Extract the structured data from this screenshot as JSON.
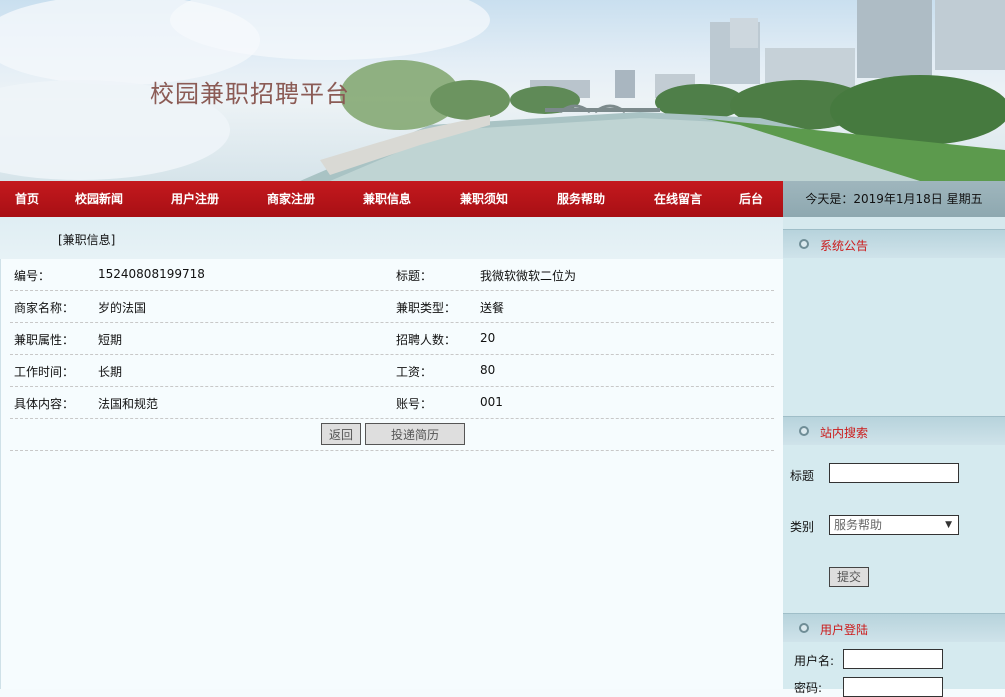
{
  "header": {
    "site_title": "校园兼职招聘平台"
  },
  "nav": {
    "items": [
      "首页",
      "校园新闻",
      "用户注册",
      "商家注册",
      "兼职信息",
      "兼职须知",
      "服务帮助",
      "在线留言",
      "后台"
    ],
    "date_text": "今天是：2019年1月18日 星期五"
  },
  "main": {
    "section_title": "[兼职信息]",
    "rows": [
      {
        "l1": "编号：",
        "v1": "15240808199718",
        "l2": "标题：",
        "v2": "我微软微软二位为"
      },
      {
        "l1": "商家名称：",
        "v1": "岁的法国",
        "l2": "兼职类型：",
        "v2": "送餐"
      },
      {
        "l1": "兼职属性：",
        "v1": "短期",
        "l2": "招聘人数：",
        "v2": "20"
      },
      {
        "l1": "工作时间：",
        "v1": "长期",
        "l2": "工资：",
        "v2": "80"
      },
      {
        "l1": "具体内容：",
        "v1": "法国和规范",
        "l2": "账号：",
        "v2": "001"
      }
    ],
    "back_button": "返回",
    "apply_button": "投递简历"
  },
  "sidebar": {
    "announcement": {
      "title": "系统公告"
    },
    "search": {
      "title": "站内搜索",
      "title_label": "标题",
      "title_value": "",
      "category_label": "类别",
      "category_selected": "服务帮助",
      "submit_label": "提交"
    },
    "login": {
      "title": "用户登陆",
      "username_label": "用户名:",
      "username_value": "",
      "password_label": "密码:"
    }
  },
  "colors": {
    "nav_red": "#b3141a",
    "panel_title_red": "#cc1a1a"
  }
}
